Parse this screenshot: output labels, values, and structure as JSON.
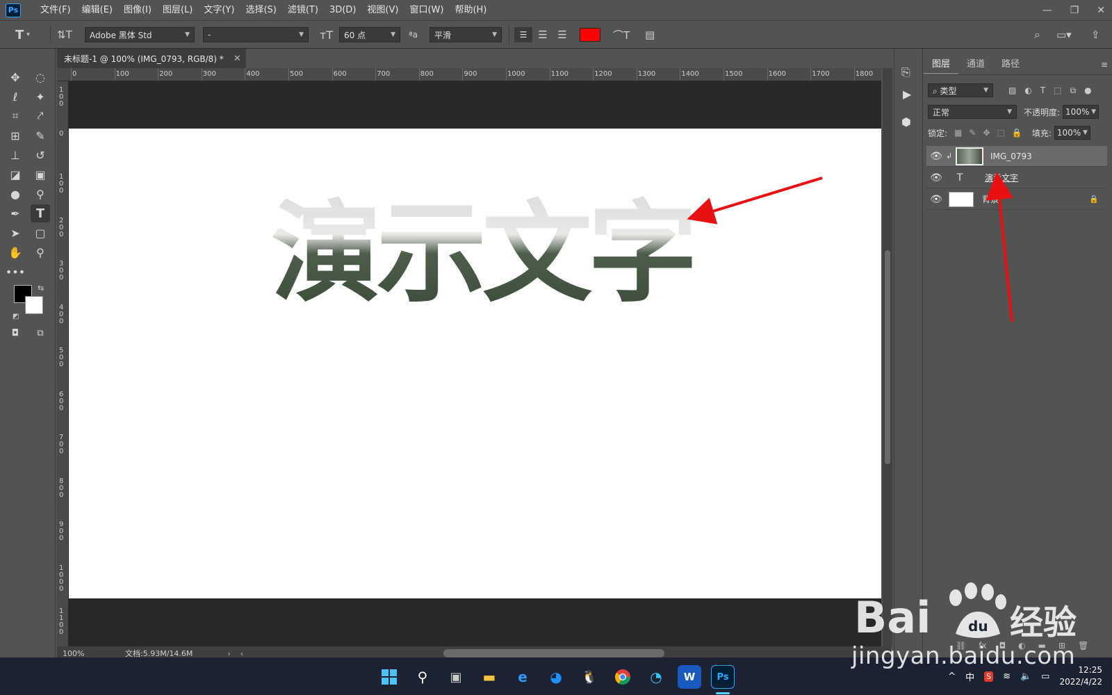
{
  "app": {
    "logo": "Ps"
  },
  "menu": [
    "文件(F)",
    "编辑(E)",
    "图像(I)",
    "图层(L)",
    "文字(Y)",
    "选择(S)",
    "滤镜(T)",
    "3D(D)",
    "视图(V)",
    "窗口(W)",
    "帮助(H)"
  ],
  "options": {
    "font_family": "Adobe 黑体 Std",
    "font_style": "-",
    "font_size": "60 点",
    "antialias": "平滑",
    "text_color": "#ff0000"
  },
  "document": {
    "tab_title": "未标题-1 @ 100% (IMG_0793, RGB/8) *",
    "canvas_text": "演示文字",
    "zoom": "100%",
    "doc_size": "文档:5.93M/14.6M"
  },
  "ruler_top": [
    "0",
    "100",
    "200",
    "300",
    "400",
    "500",
    "600",
    "700",
    "800",
    "900",
    "1000",
    "1100",
    "1200",
    "1300",
    "1400",
    "1500",
    "1600",
    "1700",
    "1800"
  ],
  "ruler_left": [
    "100",
    "0",
    "100",
    "200",
    "300",
    "400",
    "500",
    "600",
    "700",
    "800",
    "900",
    "1000",
    "1100"
  ],
  "layers_panel": {
    "tabs": [
      "图层",
      "通道",
      "路径"
    ],
    "filter_kind": "类型",
    "blend_mode": "正常",
    "opacity_label": "不透明度:",
    "opacity_value": "100%",
    "lock_label": "锁定:",
    "fill_label": "填充:",
    "fill_value": "100%",
    "layers": [
      {
        "name": "IMG_0793",
        "type": "image"
      },
      {
        "name": "演示文字",
        "type": "text"
      },
      {
        "name": "背景",
        "type": "background"
      }
    ]
  },
  "taskbar": {
    "tray_ime": "中",
    "time": "12:25",
    "date": "2022/4/22"
  },
  "watermark": {
    "site": "jingyan.baidu.com",
    "text": "jingyan.baidu.com"
  },
  "colors": {
    "ui_bg": "#535353",
    "accent_ps": "#31a8ff",
    "annotation_arrow": "#e81010"
  }
}
